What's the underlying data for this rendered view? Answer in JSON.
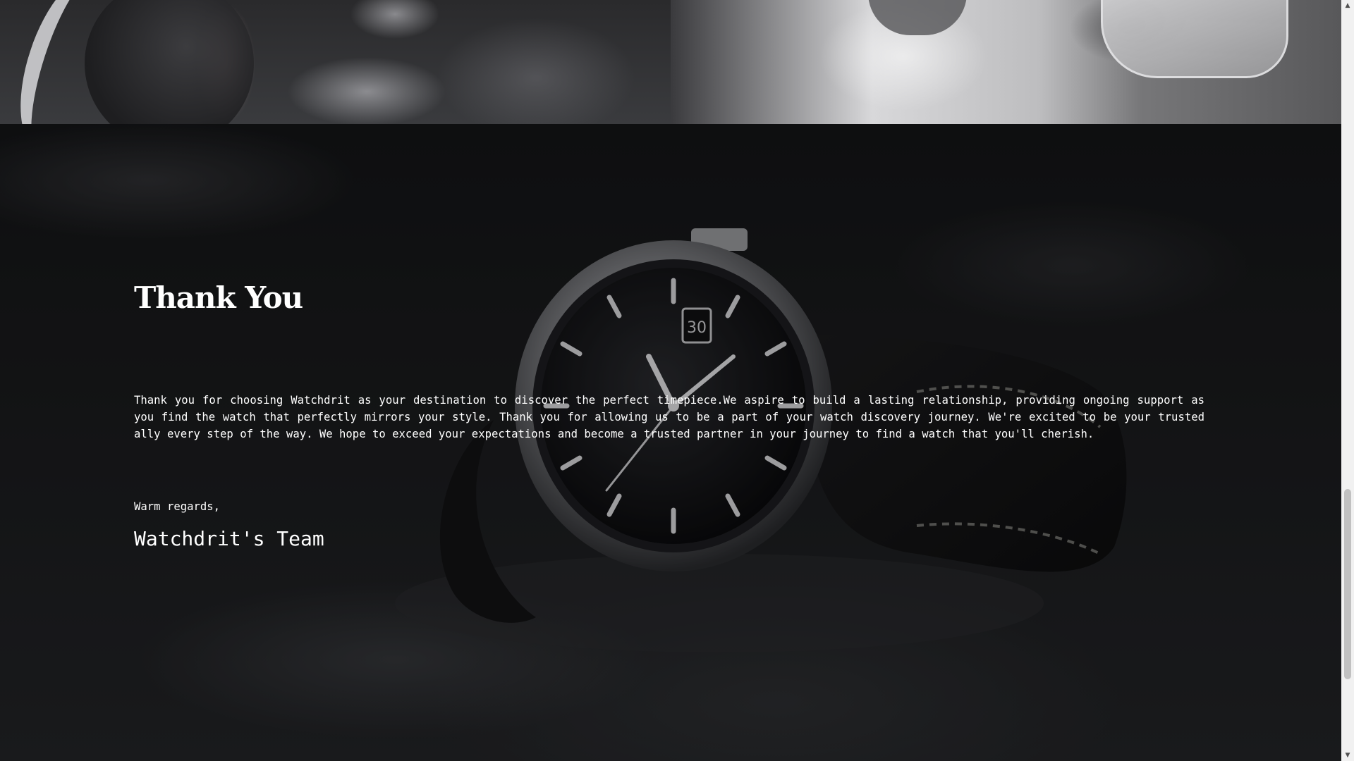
{
  "gallery": {
    "images": [
      {
        "name": "watch-on-wrist-photo"
      },
      {
        "name": "watch-held-by-man-photo"
      }
    ]
  },
  "thank_you": {
    "title": "Thank You",
    "message": "Thank you for choosing Watchdrit as your destination to discover the perfect timepiece.We aspire to build a lasting relationship, providing ongoing support as you find the watch that perfectly mirrors your style. Thank you for allowing us to be a part of your watch discovery journey. We're excited to be your trusted ally every step of the way. We hope to exceed your expectations and become a trusted partner in your journey to find a watch that you'll cherish.",
    "signoff": "Warm regards,",
    "signature": "Watchdrit's Team",
    "background_image": "wristwatch-on-dark-background",
    "watch_dial_date": "30"
  },
  "scrollbar": {
    "up_icon": "triangle-up-icon",
    "down_icon": "triangle-down-icon"
  },
  "colors": {
    "section_background": "#141517",
    "text": "#ffffff",
    "scrollbar_track": "#f1f1f1",
    "scrollbar_thumb": "#c1c1c1"
  }
}
